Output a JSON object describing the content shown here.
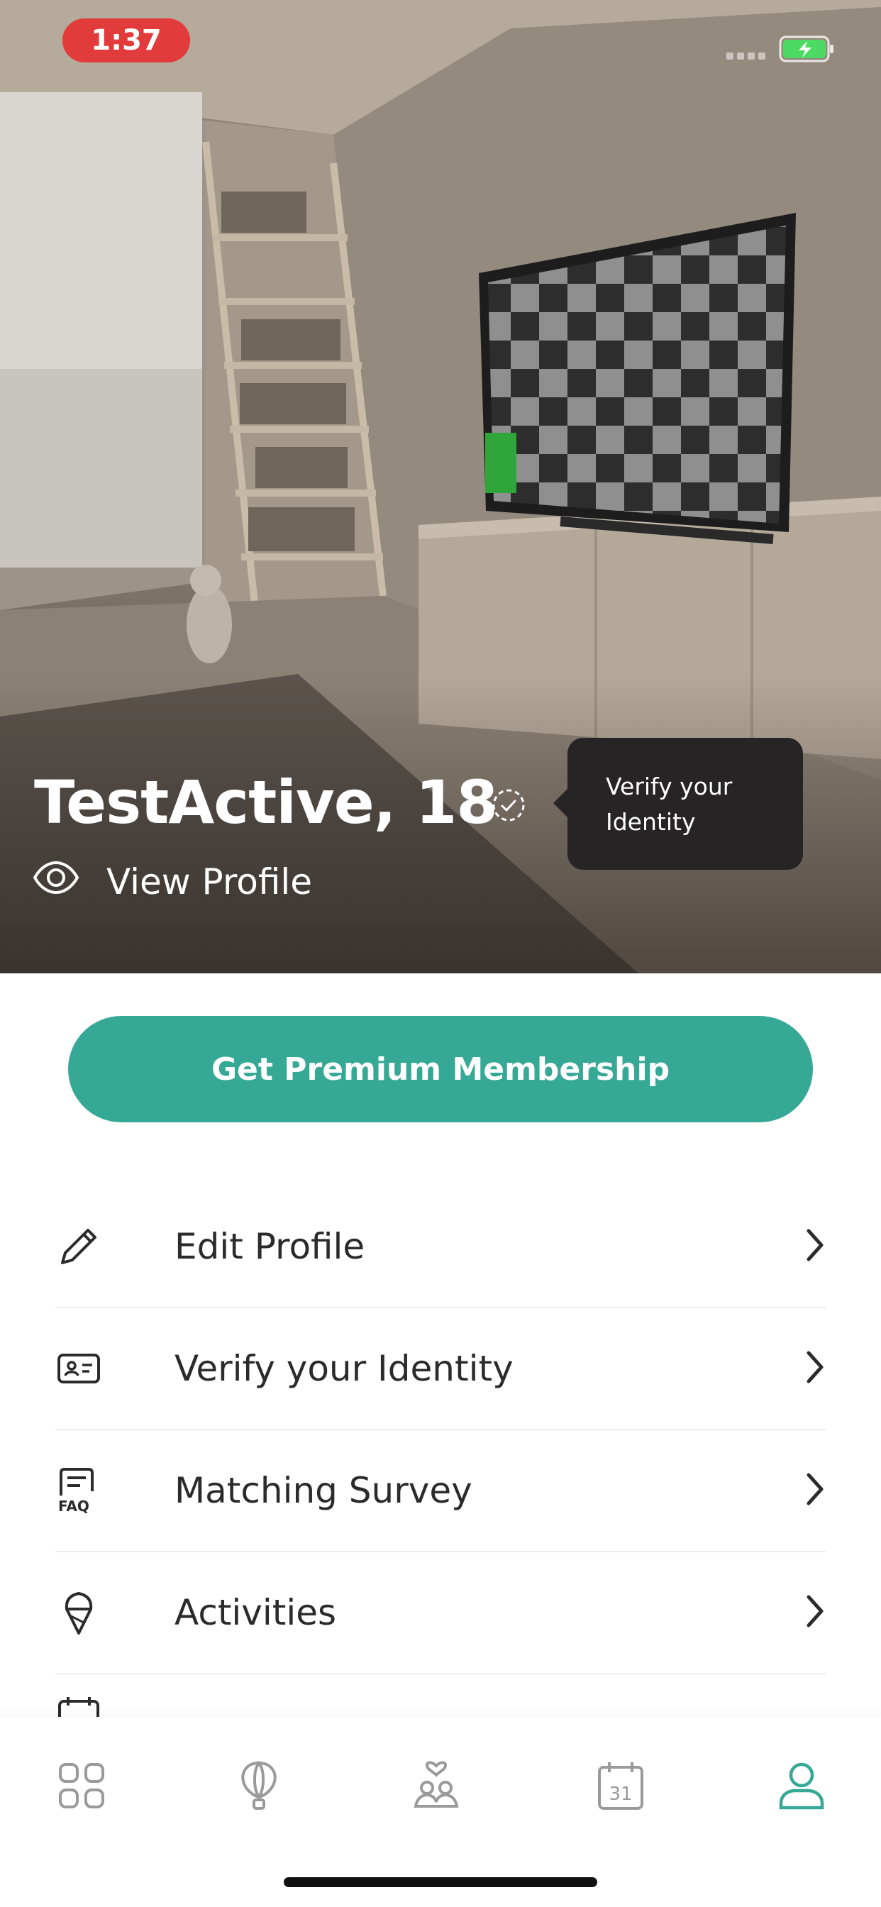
{
  "status_bar": {
    "time": "1:37"
  },
  "profile": {
    "name_age": "TestActive, 18",
    "view_profile_label": "View Profile"
  },
  "tooltip": {
    "text": "Verify your Identity"
  },
  "premium_button": {
    "label": "Get Premium Membership"
  },
  "menu": {
    "items": [
      {
        "label": "Edit Profile",
        "icon": "pencil-icon"
      },
      {
        "label": "Verify your Identity",
        "icon": "id-card-icon"
      },
      {
        "label": "Matching Survey",
        "icon": "faq-form-icon"
      },
      {
        "label": "Activities",
        "icon": "ice-cream-icon"
      },
      {
        "label": "",
        "icon": "calendar-icon"
      }
    ]
  },
  "tab_bar": {
    "tabs": [
      {
        "icon": "grid-icon",
        "active": false
      },
      {
        "icon": "balloon-icon",
        "active": false
      },
      {
        "icon": "people-heart-icon",
        "active": false
      },
      {
        "icon": "calendar-icon",
        "active": false,
        "date": "31"
      },
      {
        "icon": "user-icon",
        "active": true
      }
    ]
  },
  "colors": {
    "accent": "#36a896",
    "time_pill": "#e23b3b",
    "tooltip_bg": "#262424",
    "battery": "#4cd964"
  }
}
